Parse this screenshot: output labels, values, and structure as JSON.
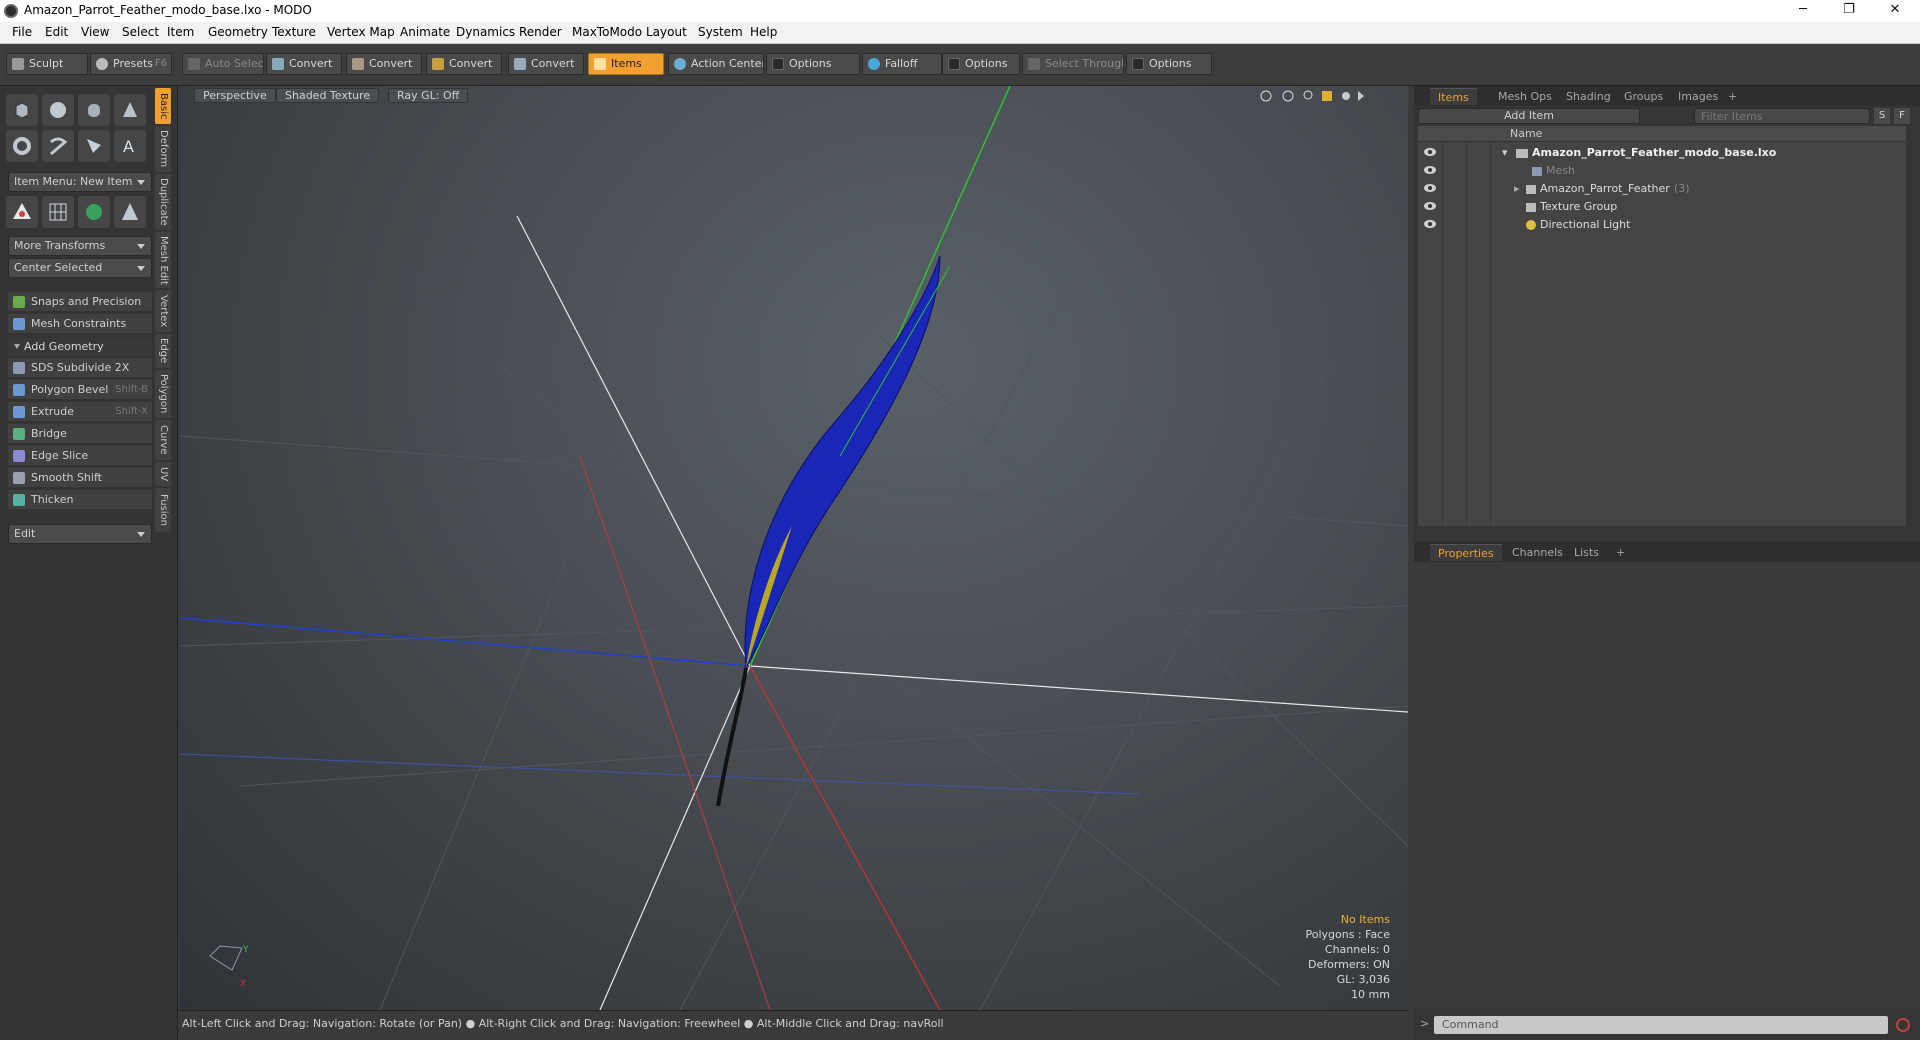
{
  "window": {
    "title": "Amazon_Parrot_Feather_modo_base.lxo - MODO",
    "min": "─",
    "max": "❐",
    "close": "✕"
  },
  "menu": [
    "File",
    "Edit",
    "View",
    "Select",
    "Item",
    "Geometry",
    "Texture",
    "Vertex Map",
    "Animate",
    "Dynamics",
    "Render",
    "MaxToModo",
    "Layout",
    "System",
    "Help"
  ],
  "toolbar": {
    "sculpt": "Sculpt",
    "presets": "Presets",
    "presets_key": "F6",
    "auto_select": "Auto Select",
    "convert1": "Convert",
    "convert2": "Convert",
    "convert3": "Convert",
    "convert4": "Convert",
    "items": "Items",
    "action_center": "Action Center",
    "options1": "Options",
    "falloff": "Falloff",
    "options2": "Options",
    "select_through": "Select Through",
    "options3": "Options"
  },
  "left": {
    "item_menu": "Item Menu: New Item",
    "more_transforms": "More Transforms",
    "center_selected": "Center Selected",
    "snaps": "Snaps and Precision",
    "mesh_constraints": "Mesh Constraints",
    "add_geometry": "Add Geometry",
    "sds": "SDS Subdivide 2X",
    "polygon_bevel": "Polygon Bevel",
    "polygon_bevel_key": "Shift-B",
    "extrude": "Extrude",
    "extrude_key": "Shift-X",
    "bridge": "Bridge",
    "edge_slice": "Edge Slice",
    "smooth_shift": "Smooth Shift",
    "thicken": "Thicken",
    "edit": "Edit"
  },
  "vtabs": [
    "Basic",
    "Deform",
    "Duplicate",
    "Mesh Edit",
    "Vertex",
    "Edge",
    "Polygon",
    "Curve",
    "UV",
    "Fusion"
  ],
  "viewport": {
    "perspective": "Perspective",
    "shaded": "Shaded Texture",
    "raygl": "Ray GL: Off",
    "info": {
      "no_items": "No Items",
      "polygons": "Polygons : Face",
      "channels": "Channels: 0",
      "deformers": "Deformers: ON",
      "gl": "GL: 3,036",
      "scale": "10 mm"
    }
  },
  "status": "Alt-Left Click and Drag: Navigation: Rotate (or Pan) ● Alt-Right Click and Drag: Navigation: Freewheel ● Alt-Middle Click and Drag: navRoll",
  "right": {
    "tabs": [
      "Items",
      "Mesh Ops",
      "Shading",
      "Groups",
      "Images",
      "+"
    ],
    "add_item": "Add Item",
    "filter_placeholder": "Filter Items",
    "s_btn": "S",
    "f_btn": "F",
    "name_col": "Name",
    "tree": [
      {
        "label": "Amazon_Parrot_Feather_modo_base.lxo"
      },
      {
        "label": "Mesh"
      },
      {
        "label": "Amazon_Parrot_Feather",
        "count": "(3)"
      },
      {
        "label": "Texture Group"
      },
      {
        "label": "Directional Light"
      }
    ],
    "prop_tabs": [
      "Properties",
      "Channels",
      "Lists",
      "+"
    ],
    "command_placeholder": "Command",
    "cmd_prompt": ">"
  }
}
